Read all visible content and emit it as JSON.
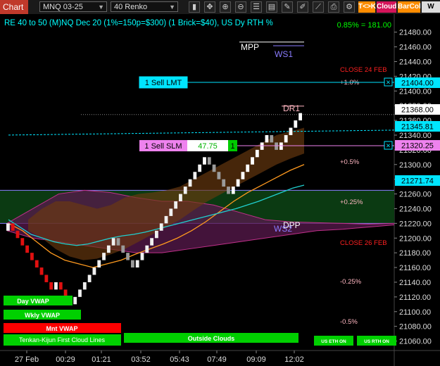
{
  "toolbar": {
    "chart_tab": "Chart",
    "instrument": "MNQ 03-25",
    "bar_type": "40 Renko",
    "btn_tk": "T<>K",
    "btn_cloud": "Cloud",
    "btn_barcol": "BarCol",
    "btn_wvw": "W VW",
    "colors": {
      "tk": "#ff8c00",
      "cloud": "#d4145a",
      "barcol": "#ff8c00",
      "wvw": "#dddddd"
    }
  },
  "header": {
    "title": "RE 40 to 50 (M)NQ Dec 20 (1%=150p=$300) (1 Brick=$40), US Dy RTH %",
    "pct_change": "0.85% = 181.00"
  },
  "orders": {
    "sell_lmt": "1 Sell LMT",
    "sell_slm": "1 Sell SLM",
    "slm_pnl": "47.75",
    "slm_qty": "1",
    "close_x": "×"
  },
  "level_labels": {
    "mpp": "MPP",
    "ws1": "WS1",
    "dr1": "DR1",
    "dpp": "DPP",
    "ws2": "WS2",
    "close_24": "CLOSE 24 FEB",
    "close_26": "CLOSE 26 FEB",
    "plus1": "+1.0%",
    "plus05": "+0.5%",
    "plus025": "+0.25%",
    "minus025": "-0.25%",
    "minus05": "-0.5%"
  },
  "legend": {
    "day_vwap": "Day VWAP",
    "wkly_vwap": "Wkly VWAP",
    "mnt_vwap": "Mnt VWAP",
    "tenkan": "Tenkan-Kijun First Cloud Lines",
    "outside_clouds": "Outside Clouds",
    "us_eth_on": "US ETH ON",
    "us_rth_on": "US RTH ON"
  },
  "price_markers": {
    "last": "21368.00",
    "vwap": "21345.81",
    "slm": "21320.25",
    "lmt": "21404.00",
    "cloud": "21271.74"
  },
  "chart_data": {
    "type": "line",
    "yaxis_ticks": [
      21480,
      21460,
      21440,
      21420,
      21400,
      21380,
      21360,
      21340,
      21320,
      21300,
      21280,
      21260,
      21240,
      21220,
      21200,
      21180,
      21160,
      21140,
      21120,
      21100,
      21080,
      21060
    ],
    "ylim": [
      21050,
      21495
    ],
    "xaxis_ticks": [
      "27 Feb",
      "00:29",
      "01:21",
      "03:52",
      "05:43",
      "07:49",
      "09:09",
      "12:02"
    ],
    "brick_size": 10,
    "renko_bricks": [
      {
        "close": 21220,
        "up": true
      },
      {
        "close": 21210,
        "up": false
      },
      {
        "close": 21200,
        "up": false
      },
      {
        "close": 21190,
        "up": false
      },
      {
        "close": 21180,
        "up": false
      },
      {
        "close": 21170,
        "up": false
      },
      {
        "close": 21160,
        "up": false
      },
      {
        "close": 21150,
        "up": false
      },
      {
        "close": 21140,
        "up": false
      },
      {
        "close": 21130,
        "up": false
      },
      {
        "close": 21140,
        "up": true
      },
      {
        "close": 21130,
        "up": false
      },
      {
        "close": 21120,
        "up": false
      },
      {
        "close": 21110,
        "up": false
      },
      {
        "close": 21120,
        "up": true
      },
      {
        "close": 21130,
        "up": true
      },
      {
        "close": 21140,
        "up": true
      },
      {
        "close": 21150,
        "up": true
      },
      {
        "close": 21160,
        "up": true
      },
      {
        "close": 21170,
        "up": true
      },
      {
        "close": 21180,
        "up": true
      },
      {
        "close": 21190,
        "up": true
      },
      {
        "close": 21200,
        "up": true
      },
      {
        "close": 21190,
        "up": false
      },
      {
        "close": 21180,
        "up": false
      },
      {
        "close": 21170,
        "up": false
      },
      {
        "close": 21160,
        "up": false
      },
      {
        "close": 21170,
        "up": true
      },
      {
        "close": 21180,
        "up": true
      },
      {
        "close": 21190,
        "up": true
      },
      {
        "close": 21200,
        "up": true
      },
      {
        "close": 21210,
        "up": true
      },
      {
        "close": 21220,
        "up": true
      },
      {
        "close": 21230,
        "up": true
      },
      {
        "close": 21240,
        "up": true
      },
      {
        "close": 21250,
        "up": true
      },
      {
        "close": 21260,
        "up": true
      },
      {
        "close": 21270,
        "up": true
      },
      {
        "close": 21280,
        "up": true
      },
      {
        "close": 21290,
        "up": true
      },
      {
        "close": 21300,
        "up": true
      },
      {
        "close": 21310,
        "up": true
      },
      {
        "close": 21300,
        "up": false
      },
      {
        "close": 21290,
        "up": false
      },
      {
        "close": 21280,
        "up": false
      },
      {
        "close": 21270,
        "up": false
      },
      {
        "close": 21260,
        "up": false
      },
      {
        "close": 21270,
        "up": true
      },
      {
        "close": 21280,
        "up": true
      },
      {
        "close": 21290,
        "up": true
      },
      {
        "close": 21300,
        "up": true
      },
      {
        "close": 21310,
        "up": true
      },
      {
        "close": 21320,
        "up": true
      },
      {
        "close": 21330,
        "up": true
      },
      {
        "close": 21340,
        "up": true
      },
      {
        "close": 21330,
        "up": false
      },
      {
        "close": 21320,
        "up": false
      },
      {
        "close": 21330,
        "up": true
      },
      {
        "close": 21340,
        "up": true
      },
      {
        "close": 21350,
        "up": true
      },
      {
        "close": 21360,
        "up": true
      },
      {
        "close": 21370,
        "up": true
      }
    ],
    "vwap_line": [
      21225,
      21215,
      21205,
      21200,
      21195,
      21192,
      21190,
      21192,
      21196,
      21200,
      21203,
      21205,
      21208,
      21212,
      21216,
      21220,
      21224,
      21228,
      21232,
      21236,
      21240,
      21245,
      21250,
      21256,
      21262,
      21268,
      21272
    ],
    "orange_line": [
      21220,
      21210,
      21195,
      21180,
      21170,
      21165,
      21160,
      21165,
      21170,
      21178,
      21185,
      21192,
      21200,
      21210,
      21222,
      21236,
      21250,
      21262,
      21272,
      21282,
      21292,
      21300
    ],
    "cloud_upper": [
      21225,
      21240,
      21250,
      21250,
      21245,
      21240,
      21245,
      21255,
      21260,
      21262,
      21265,
      21270,
      21280,
      21290,
      21300,
      21310,
      21320,
      21330,
      21340,
      21345,
      21350
    ],
    "cloud_lower": [
      21210,
      21200,
      21185,
      21175,
      21170,
      21172,
      21178,
      21185,
      21195,
      21205,
      21215,
      21225,
      21238,
      21250,
      21260,
      21270,
      21280,
      21290,
      21300,
      21308,
      21315
    ],
    "magenta_upper": [
      21220,
      21240,
      21260,
      21265,
      21262,
      21255,
      21250,
      21250,
      21245,
      21235,
      21225,
      21222,
      21221,
      21220,
      21219,
      21220
    ],
    "magenta_lower": [
      21210,
      21200,
      21195,
      21190,
      21185,
      21180,
      21180,
      21185,
      21190,
      21195,
      21200,
      21205,
      21210,
      21212,
      21215,
      21218
    ],
    "levels": {
      "mpp": 21455,
      "ws1": 21450,
      "dr1": 21368,
      "dpp": 21220,
      "ws2": 21215,
      "close_24": 21427,
      "close_26": 21187,
      "plus1": 21404,
      "plus05": 21306,
      "plus025": 21245,
      "minus025": 21153,
      "minus05": 21096,
      "sell_lmt": 21404,
      "sell_slm": 21320,
      "vwap_dotted": 21345.81,
      "last": 21368,
      "green_band": [
        21220,
        21265
      ]
    }
  }
}
